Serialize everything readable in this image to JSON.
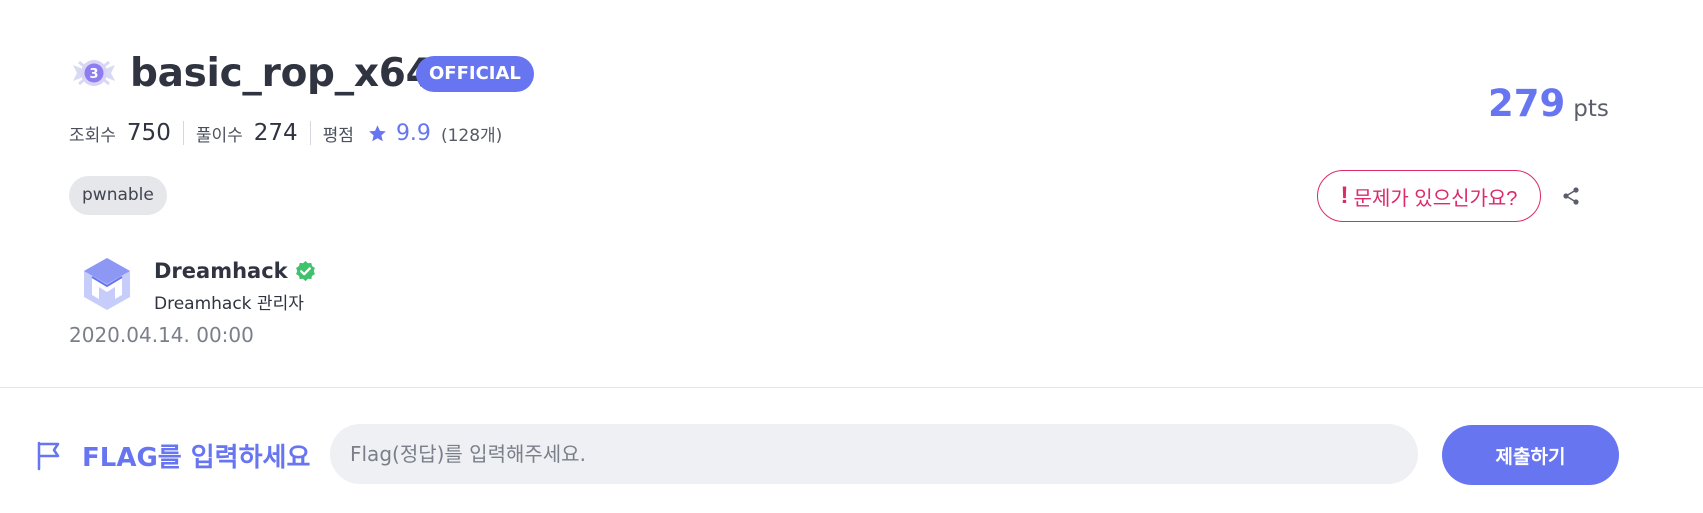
{
  "challenge": {
    "level": "3",
    "title": "basic_rop_x64",
    "official_label": "OFFICIAL",
    "stats": {
      "views_label": "조회수",
      "views": "750",
      "solves_label": "풀이수",
      "solves": "274",
      "rating_label": "평점",
      "rating": "9.9",
      "rating_count": "(128개)"
    },
    "tag": "pwnable",
    "author": {
      "name": "Dreamhack",
      "role": "Dreamhack 관리자",
      "verified": true
    },
    "date": "2020.04.14. 00:00",
    "points": "279",
    "points_unit": "pts",
    "report_label": "문제가 있으신가요?",
    "report_mark": "!"
  },
  "flag_submit": {
    "label": "FLAG를 입력하세요",
    "placeholder": "Flag(정답)를 입력해주세요.",
    "value": "",
    "submit_label": "제출하기"
  },
  "colors": {
    "accent": "#6775f0",
    "danger": "#dc2a6a",
    "verified": "#3ec26b",
    "tag_bg": "#e6e7eb",
    "input_bg": "#eff0f4"
  },
  "icons": {
    "level": "level-3-badge-icon",
    "star": "star-icon",
    "verified": "verified-check-icon",
    "share": "share-icon",
    "flag": "flag-icon",
    "author_logo": "dreamhack-logo-icon"
  }
}
